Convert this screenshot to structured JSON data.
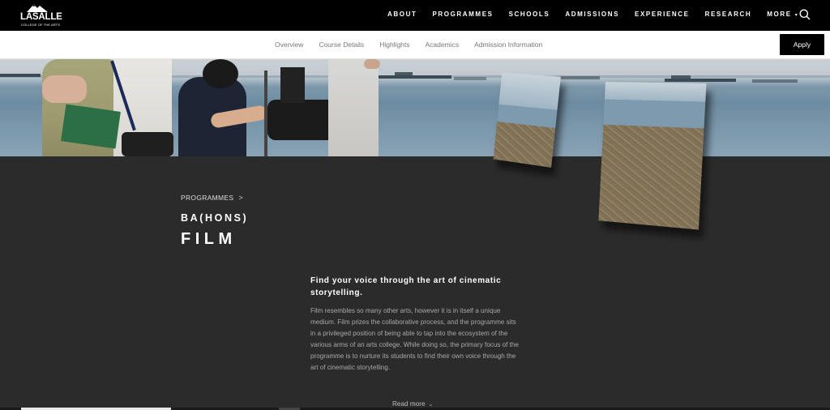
{
  "logo": {
    "name": "LASALLE",
    "subtitle": "COLLEGE OF THE ARTS"
  },
  "main_nav": {
    "items": [
      "ABOUT",
      "PROGRAMMES",
      "SCHOOLS",
      "ADMISSIONS",
      "EXPERIENCE",
      "RESEARCH",
      "MORE"
    ],
    "more_caret": "▾",
    "search_icon": "search-icon"
  },
  "sub_nav": {
    "items": [
      "Overview",
      "Course Details",
      "Highlights",
      "Academics",
      "Admission Information"
    ],
    "apply_label": "Apply"
  },
  "hero": {
    "breadcrumb": "PROGRAMMES",
    "breadcrumb_separator": ">",
    "degree": "BA(HONS)",
    "title": "FILM"
  },
  "intro": {
    "tagline": "Find your voice through the art of cinematic storytelling.",
    "body": "Film resembles so many other arts, however it is in itself a unique medium. Film prizes the collaborative process, and the programme sits in a privileged position of being able to tap into the ecosystem of the various arms of an arts college. While doing so, the primary focus of the programme is to nurture its students to find their own voice through the art of cinematic storytelling.",
    "read_more": "Read more",
    "read_more_icon": "⌄"
  },
  "colors": {
    "topbar": "#000000",
    "content_bg": "#2b2b2b",
    "subnav_bg": "#ffffff",
    "apply_bg": "#000000"
  }
}
